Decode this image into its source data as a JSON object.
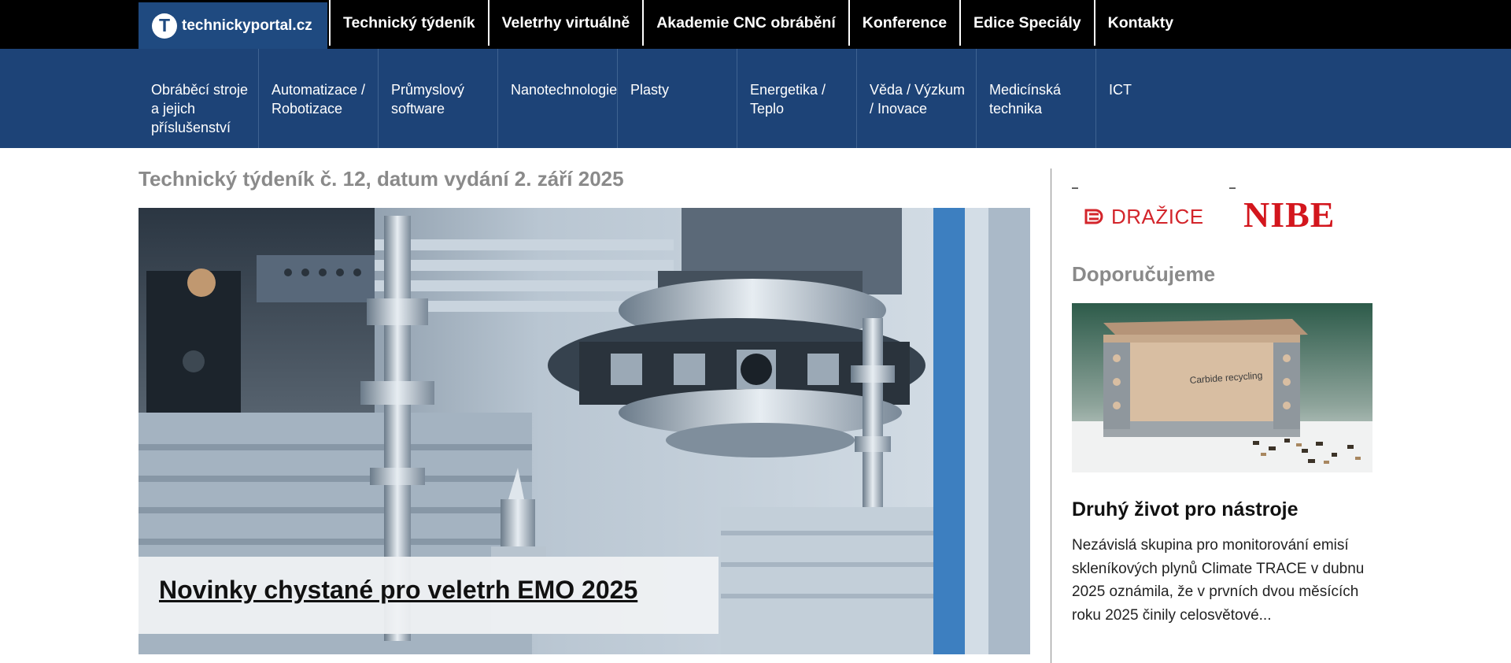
{
  "site": {
    "logo_letter": "T",
    "logo_text": "technickyportal.cz"
  },
  "topnav": {
    "items": [
      {
        "label": "Technický týdeník"
      },
      {
        "label": "Veletrhy virtuálně"
      },
      {
        "label": "Akademie CNC obrábění"
      },
      {
        "label": "Konference"
      },
      {
        "label": "Edice Speciály"
      },
      {
        "label": "Kontakty"
      }
    ]
  },
  "categories": {
    "items": [
      {
        "label": "Obráběcí stroje a jejich příslušenství"
      },
      {
        "label": "Automatizace / Robotizace"
      },
      {
        "label": "Průmyslový software"
      },
      {
        "label": "Nanotechnologie"
      },
      {
        "label": "Plasty"
      },
      {
        "label": "Energetika / Teplo"
      },
      {
        "label": "Věda / Výzkum / Inovace"
      },
      {
        "label": "Medicínská technika"
      },
      {
        "label": "ICT"
      }
    ]
  },
  "main": {
    "issue_title": "Technický týdeník č. 12, datum vydání 2. září 2025",
    "hero": {
      "headline": "Novinky chystané pro veletrh EMO 2025"
    }
  },
  "sidebar": {
    "ads": {
      "drazice_text": "DRAŽICE",
      "nibe_text": "NIBE"
    },
    "recommended_title": "Doporučujeme",
    "recommended": {
      "image_label": "Carbide recycling",
      "headline": "Druhý život pro nástroje",
      "excerpt": "Nezávislá skupina pro monitorování emisí skleníkových plynů Climate TRACE v dubnu 2025 oznámila, že v prvních dvou měsících roku 2025 činily celosvětové..."
    }
  },
  "colors": {
    "topbar": "#000000",
    "logo_bg": "#1f4a80",
    "category_bar": "#1d4377",
    "heading_gray": "#8a8a8a",
    "brand_red": "#d3252b"
  }
}
